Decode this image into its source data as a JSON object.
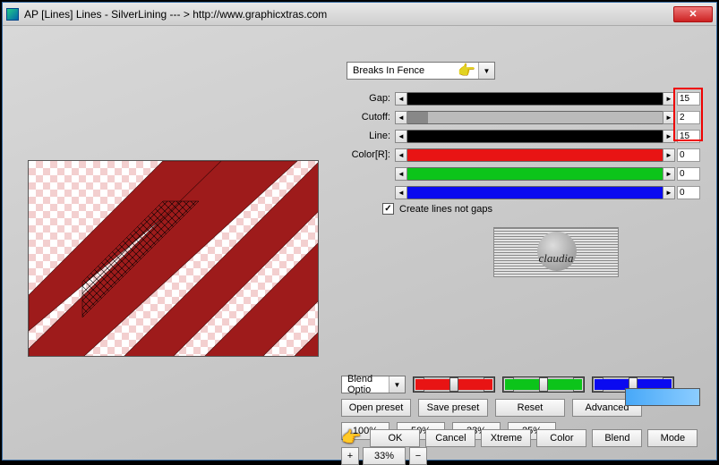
{
  "titlebar": {
    "title": "AP [Lines]  Lines - SilverLining    --- >  http://www.graphicxtras.com"
  },
  "preset": {
    "selected": "Breaks In Fence"
  },
  "sliders": {
    "gap": {
      "label": "Gap:",
      "value": "15"
    },
    "cutoff": {
      "label": "Cutoff:",
      "value": "2"
    },
    "line": {
      "label": "Line:",
      "value": "15"
    },
    "colorR": {
      "label": "Color[R]:",
      "value": "0"
    },
    "colorG": {
      "label": "",
      "value": "0"
    },
    "colorB": {
      "label": "",
      "value": "0"
    }
  },
  "checkbox": {
    "create_lines_label": "Create lines not gaps",
    "checked": true
  },
  "logo": {
    "text": "claudia"
  },
  "blend_options": {
    "label": "Blend Optio"
  },
  "preset_buttons": {
    "open": "Open preset",
    "save": "Save preset",
    "reset": "Reset",
    "advanced": "Advanced"
  },
  "zoom_levels": {
    "z100": "100%",
    "z50": "50%",
    "z33": "33%",
    "z25": "25%"
  },
  "zoom": {
    "plus": "+",
    "value": "33%",
    "minus": "−"
  },
  "bottom": {
    "ok": "OK",
    "cancel": "Cancel",
    "xtreme": "Xtreme",
    "color": "Color",
    "blend": "Blend",
    "mode": "Mode"
  },
  "colors": {
    "red": "#e81414",
    "green": "#0cc41a",
    "blue": "#0a0af0",
    "preview_red": "#9e1b1b",
    "swatch": "#5cb4fa"
  }
}
